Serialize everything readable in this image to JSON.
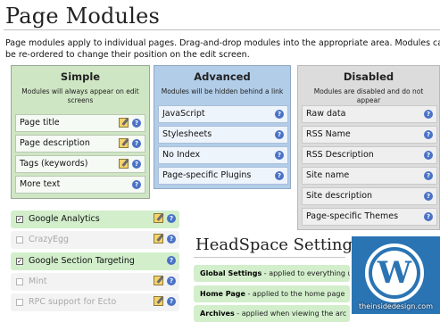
{
  "page": {
    "title": "Page Modules",
    "intro_line1": "Page modules apply to individual pages. Drag-and-drop modules into the appropriate area. Modules can",
    "intro_line2": "be re-ordered to change their position on the edit screen."
  },
  "columns": {
    "simple": {
      "heading": "Simple",
      "subtitle": "Modules will always appear on edit screens",
      "items": [
        "Page title",
        "Page description",
        "Tags (keywords)",
        "More text"
      ]
    },
    "advanced": {
      "heading": "Advanced",
      "subtitle": "Modules will be hidden behind a link",
      "items": [
        "JavaScript",
        "Stylesheets",
        "No Index",
        "Page-specific Plugins"
      ]
    },
    "disabled": {
      "heading": "Disabled",
      "subtitle": "Modules are disabled and do not appear",
      "items": [
        "Raw data",
        "RSS Name",
        "RSS Description",
        "Site name",
        "Site description",
        "Page-specific Themes"
      ]
    }
  },
  "plugins": [
    {
      "label": "Google Analytics",
      "checked": true
    },
    {
      "label": "CrazyEgg",
      "checked": false
    },
    {
      "label": "Google Section Targeting",
      "checked": true
    },
    {
      "label": "Mint",
      "checked": false
    },
    {
      "label": "RPC support for Ecto",
      "checked": false
    }
  ],
  "headspace": {
    "title": "HeadSpace Settings",
    "rows": [
      {
        "name": "Global Settings",
        "desc": " - applied to everything u"
      },
      {
        "name": "Home Page",
        "desc": " - applied to the home page"
      },
      {
        "name": "Archives",
        "desc": " - applied when viewing the arc"
      }
    ]
  },
  "icons": {
    "help": "question-mark-icon",
    "edit": "edit-pencil-icon",
    "checkbox_mark": "✓",
    "logo": "wordpress-logo"
  },
  "watermark": "theinsidedesign.com",
  "colors": {
    "simple_bg": "#cfe6c4",
    "advanced_bg": "#b2cde8",
    "disabled_bg": "#dcdcdc",
    "plugin_on_bg": "#d2eecb",
    "wordpress_blue": "#2a74b4"
  }
}
